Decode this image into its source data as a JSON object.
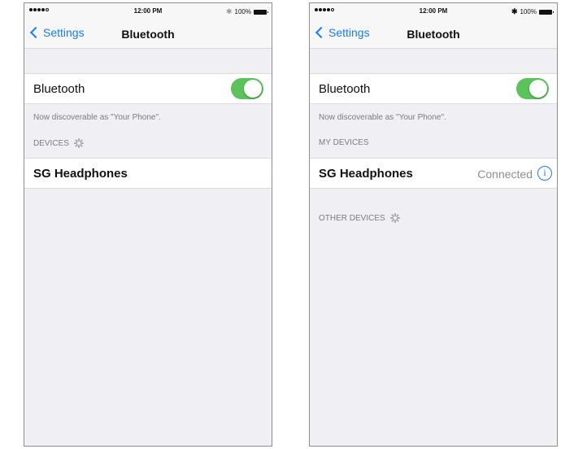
{
  "status_bar": {
    "time": "12:00 PM",
    "battery": "100%"
  },
  "nav": {
    "back_label": "Settings",
    "title": "Bluetooth"
  },
  "bluetooth_row": {
    "label": "Bluetooth",
    "enabled": true,
    "toggle_color": "#5ac35a"
  },
  "discoverable_note": "Now discoverable as \"Your Phone\".",
  "left_screen": {
    "section_header": "DEVICES",
    "device_name": "SG Headphones"
  },
  "right_screen": {
    "my_devices_header": "MY DEVICES",
    "device_name": "SG Headphones",
    "device_status": "Connected",
    "info_icon": "i",
    "other_devices_header": "OTHER DEVICES"
  },
  "colors": {
    "accent": "#147efb",
    "background": "#efeff4"
  }
}
